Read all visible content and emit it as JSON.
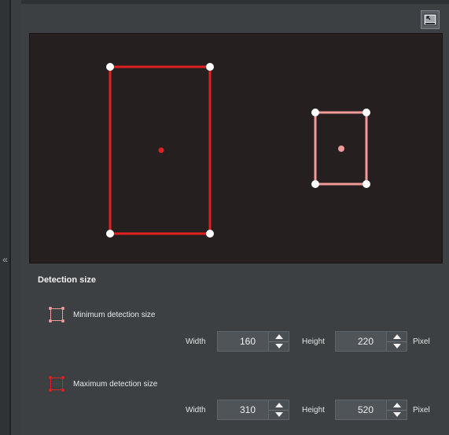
{
  "colors": {
    "min_color": "#f09a9a",
    "max_color": "#e02020",
    "handle": "#ffffff",
    "preview_bg": "#261f1f",
    "panel_bg": "#3c4043"
  },
  "icons": {
    "fullscreen_toggle": "restore-window-icon",
    "collapse": "double-chevron-left-icon",
    "stepper_up": "triangle-up-icon",
    "stepper_down": "triangle-down-icon"
  },
  "collapse_arrow": "«",
  "detection": {
    "section_title": "Detection size",
    "minimum": {
      "label": "Minimum detection size",
      "width_label": "Width",
      "width_value": "160",
      "height_label": "Height",
      "height_value": "220",
      "unit": "Pixel"
    },
    "maximum": {
      "label": "Maximum detection size",
      "width_label": "Width",
      "width_value": "310",
      "height_label": "Height",
      "height_value": "520",
      "unit": "Pixel"
    }
  }
}
